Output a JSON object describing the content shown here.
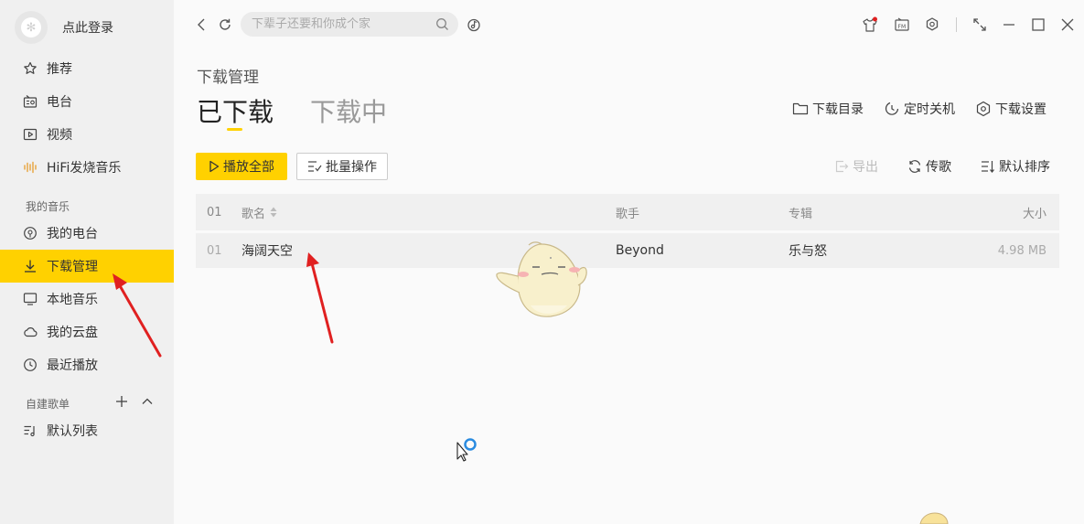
{
  "colors": {
    "accent": "#ffd100",
    "sidebar_bg": "#f0f0f0",
    "arrow": "#e02020",
    "badge": "#e02020"
  },
  "sidebar": {
    "login_label": "点此登录",
    "nav": [
      {
        "label": "推荐",
        "icon": "star-icon"
      },
      {
        "label": "电台",
        "icon": "radio-icon"
      },
      {
        "label": "视频",
        "icon": "video-icon"
      },
      {
        "label": "HiFi发烧音乐",
        "icon": "hifi-wave-icon"
      }
    ],
    "my_music_label": "我的音乐",
    "my_music": [
      {
        "label": "我的电台",
        "icon": "podcast-icon"
      },
      {
        "label": "下载管理",
        "icon": "download-icon",
        "active": true
      },
      {
        "label": "本地音乐",
        "icon": "monitor-icon"
      },
      {
        "label": "我的云盘",
        "icon": "cloud-icon"
      },
      {
        "label": "最近播放",
        "icon": "clock-icon"
      }
    ],
    "playlist_section_label": "自建歌单",
    "playlists": [
      {
        "label": "默认列表",
        "icon": "playlist-icon"
      }
    ]
  },
  "topbar": {
    "search_placeholder": "下辈子还要和你成个家"
  },
  "main": {
    "page_title": "下载管理",
    "tabs": [
      {
        "label": "已下载",
        "active": true
      },
      {
        "label": "下载中",
        "active": false
      }
    ],
    "toolbar_links": {
      "download_dir": "下载目录",
      "timer_shutdown": "定时关机",
      "download_settings": "下载设置"
    },
    "buttons": {
      "play_all": "播放全部",
      "batch_ops": "批量操作"
    },
    "list_actions": {
      "export": "导出",
      "transfer": "传歌",
      "default_sort": "默认排序"
    },
    "table": {
      "headers": {
        "no": "01",
        "title": "歌名",
        "artist": "歌手",
        "album": "专辑",
        "size": "大小"
      },
      "rows": [
        {
          "no": "01",
          "title": "海阔天空",
          "artist": "Beyond",
          "album": "乐与怒",
          "size": "4.98 MB"
        }
      ]
    }
  }
}
